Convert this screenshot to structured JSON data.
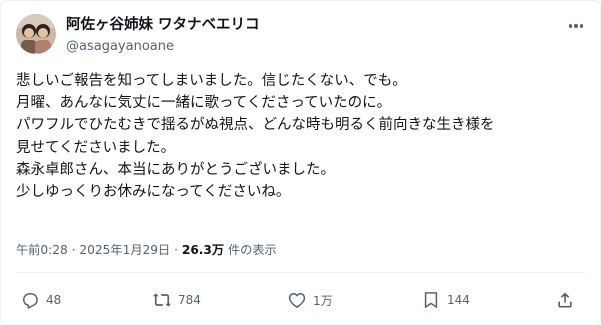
{
  "author": {
    "display_name": "阿佐ヶ谷姉妹 ワタナベエリコ",
    "handle": "@asagayanoane",
    "avatar_icon": "avatar-photo"
  },
  "post": {
    "lines": [
      "悲しいご報告を知ってしまいました。信じたくない、でも。",
      "月曜、あんなに気丈に一緒に歌ってくださっていたのに。",
      "パワフルでひたむきで揺るがぬ視点、どんな時も明るく前向きな生き様を",
      "見せてくださいました。",
      "森永卓郎さん、本当にありがとうございました。",
      "少しゆっくりお休みになってくださいね。"
    ]
  },
  "meta": {
    "timestamp": "午前0:28 · 2025年1月29日",
    "separator": " · ",
    "views_count": "26.3万",
    "views_label": "件の表示"
  },
  "actions": {
    "reply_count": "48",
    "repost_count": "784",
    "like_count": "1万",
    "bookmark_count": "144"
  },
  "colors": {
    "text": "#0f1419",
    "secondary": "#536471",
    "border": "#eff3f4"
  }
}
